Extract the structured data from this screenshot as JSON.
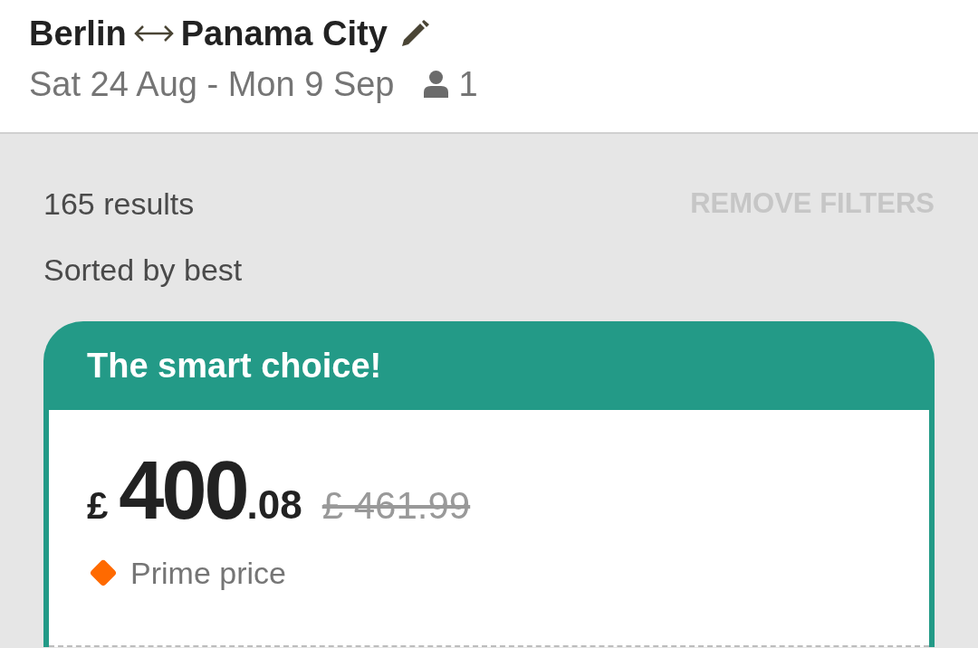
{
  "header": {
    "origin": "Berlin",
    "destination": "Panama City",
    "dates": "Sat 24 Aug - Mon 9 Sep",
    "passengers": "1"
  },
  "results": {
    "count": "165 results",
    "remove_filters": {
      "label": "REMOVE FILTERS",
      "disabled": true
    },
    "sort": "Sorted by best"
  },
  "card": {
    "title": "The smart choice!",
    "price": {
      "currency": "£",
      "whole": "400",
      "fraction": ".08"
    },
    "old_price": "£ 461.99",
    "badge": "Prime price"
  }
}
